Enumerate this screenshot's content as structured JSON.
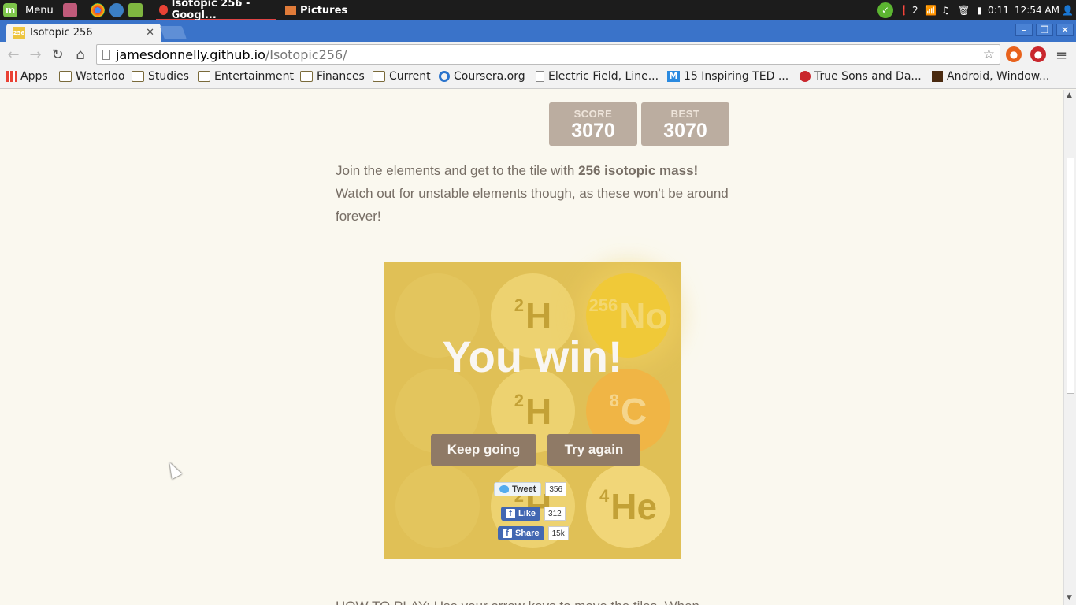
{
  "taskbar": {
    "menu_label": "Menu",
    "tasks": [
      {
        "label": "Isotopic 256 - Googl...",
        "active": true
      },
      {
        "label": "Pictures",
        "active": false
      }
    ],
    "tray": {
      "notification_count": "2",
      "battery": "0:11",
      "clock": "12:54 AM"
    }
  },
  "browser": {
    "tab_title": "Isotopic 256",
    "favicon_text": "256",
    "url_host": "jamesdonnelly.github.io",
    "url_path": "/Isotopic256/",
    "bookmarks": [
      {
        "label": "Apps",
        "icon": "apps-grid-icon"
      },
      {
        "label": "Waterloo",
        "icon": "folder-icon"
      },
      {
        "label": "Studies",
        "icon": "folder-icon"
      },
      {
        "label": "Entertainment",
        "icon": "folder-icon"
      },
      {
        "label": "Finances",
        "icon": "folder-icon"
      },
      {
        "label": "Current",
        "icon": "folder-icon"
      },
      {
        "label": "Coursera.org",
        "icon": "coursera-icon"
      },
      {
        "label": "Electric Field, Line...",
        "icon": "page-icon"
      },
      {
        "label": "15 Inspiring TED ...",
        "icon": "medium-icon"
      },
      {
        "label": "True Sons and Da...",
        "icon": "site-icon"
      },
      {
        "label": "Android, Window...",
        "icon": "xda-icon"
      }
    ]
  },
  "game": {
    "score_label": "SCORE",
    "score": "3070",
    "best_label": "BEST",
    "best": "3070",
    "intro_pre": "Join the elements and get to the tile with ",
    "intro_bold": "256 isotopic mass!",
    "intro_post": " Watch out for unstable elements though, as these won't be around forever!",
    "tiles": [
      {
        "mass": "2",
        "symbol": "H"
      },
      {
        "mass": "256",
        "symbol": "No"
      },
      {
        "mass": "2",
        "symbol": "H"
      },
      {
        "mass": "8",
        "symbol": "C"
      },
      {
        "mass": "2",
        "symbol": "H"
      },
      {
        "mass": "4",
        "symbol": "He"
      }
    ],
    "win_message": "You win!",
    "keep_going_label": "Keep going",
    "try_again_label": "Try again",
    "social": {
      "tweet_label": "Tweet",
      "tweet_count": "356",
      "like_label": "Like",
      "like_count": "312",
      "share_label": "Share",
      "share_count": "15k"
    },
    "howto_text": "HOW TO PLAY: Use your arrow keys to move the tiles. When"
  }
}
